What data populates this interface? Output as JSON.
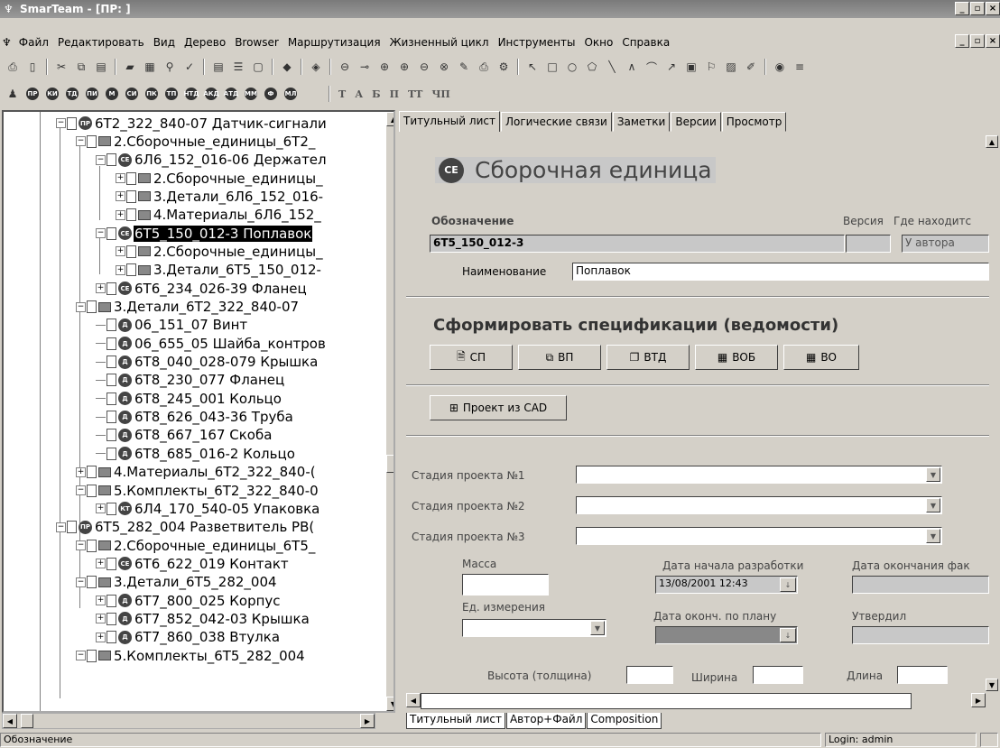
{
  "app": {
    "title": "SmarTeam - [ПР: ]"
  },
  "menu": [
    "Файл",
    "Редактировать",
    "Вид",
    "Дерево",
    "Browser",
    "Маршрутизация",
    "Жизненный цикл",
    "Инструменты",
    "Окно",
    "Справка"
  ],
  "formatting": [
    "Т",
    "А",
    "Б",
    "П",
    "ТТ",
    "ЧП"
  ],
  "tree": [
    {
      "label": "6Т2_322_840-07 Датчик-сигнали",
      "icon": "ПР"
    },
    {
      "label": "2.Сборочные_единицы_6Т2_",
      "icon": "folder"
    },
    {
      "label": "6Л6_152_016-06 Держател",
      "icon": "СЕ"
    },
    {
      "label": "2.Сборочные_единицы_",
      "icon": "folder"
    },
    {
      "label": "3.Детали_6Л6_152_016-",
      "icon": "folder"
    },
    {
      "label": "4.Материалы_6Л6_152_",
      "icon": "folder"
    },
    {
      "label": "6Т5_150_012-3 Поплавок",
      "icon": "СЕ",
      "selected": true
    },
    {
      "label": "2.Сборочные_единицы_",
      "icon": "folder"
    },
    {
      "label": "3.Детали_6Т5_150_012-",
      "icon": "folder"
    },
    {
      "label": "6Т6_234_026-39 Фланец",
      "icon": "СЕ"
    },
    {
      "label": "3.Детали_6Т2_322_840-07",
      "icon": "folder"
    },
    {
      "label": "06_151_07 Винт",
      "icon": "Д"
    },
    {
      "label": "06_655_05 Шайба_контров",
      "icon": "Д"
    },
    {
      "label": "6Т8_040_028-079 Крышка",
      "icon": "Д"
    },
    {
      "label": "6Т8_230_077 Фланец",
      "icon": "Д"
    },
    {
      "label": "6Т8_245_001 Кольцо",
      "icon": "Д"
    },
    {
      "label": "6Т8_626_043-36 Труба",
      "icon": "Д"
    },
    {
      "label": "6Т8_667_167 Скоба",
      "icon": "Д"
    },
    {
      "label": "6Т8_685_016-2 Кольцо",
      "icon": "Д"
    },
    {
      "label": "4.Материалы_6Т2_322_840-(",
      "icon": "folder"
    },
    {
      "label": "5.Комплекты_6Т2_322_840-0",
      "icon": "folder"
    },
    {
      "label": "6Л4_170_540-05 Упаковка",
      "icon": "КТ"
    },
    {
      "label": "6Т5_282_004 Разветвитель РВ(",
      "icon": "ПР"
    },
    {
      "label": "2.Сборочные_единицы_6Т5_",
      "icon": "folder"
    },
    {
      "label": "6Т6_622_019 Контакт",
      "icon": "СЕ"
    },
    {
      "label": "3.Детали_6Т5_282_004",
      "icon": "folder"
    },
    {
      "label": "6Т7_800_025 Корпус",
      "icon": "Д"
    },
    {
      "label": "6Т7_852_042-03 Крышка",
      "icon": "Д"
    },
    {
      "label": "6Т7_860_038 Втулка",
      "icon": "Д"
    },
    {
      "label": "5.Комплекты_6Т5_282_004",
      "icon": "folder"
    }
  ],
  "tabs": [
    "Титульный лист",
    "Логические связи",
    "Заметки",
    "Версии",
    "Просмотр"
  ],
  "form": {
    "header": "Сборочная единица",
    "header_icon": "СЕ",
    "designation_label": "Обозначение",
    "designation_value": "6Т5_150_012-3",
    "version_label": "Версия",
    "location_label": "Где находитс",
    "location_value": "У автора",
    "name_label": "Наименование",
    "name_value": "Поплавок",
    "spec_title": "Сформировать спецификации (ведомости)",
    "spec_buttons": [
      "СП",
      "ВП",
      "ВТД",
      "ВОБ",
      "ВО"
    ],
    "cad_button": "Проект из CAD",
    "stage1": "Стадия проекта №1",
    "stage2": "Стадия проекта №2",
    "stage3": "Стадия проекта №3",
    "mass": "Масса",
    "start_date_label": "Дата начала разработки",
    "start_date_value": "13/08/2001 12:43",
    "end_fact_label": "Дата окончания фак",
    "unit_label": "Ед. измерения",
    "plan_end_label": "Дата оконч. по плану",
    "approved_label": "Утвердил",
    "height_label": "Высота (толщина)",
    "width_label": "Ширина",
    "length_label": "Длина"
  },
  "bottom_tabs": [
    "Титульный лист",
    "Автор+Файл",
    "Composition"
  ],
  "status": {
    "left": "Обозначение",
    "login": "Login: admin"
  }
}
